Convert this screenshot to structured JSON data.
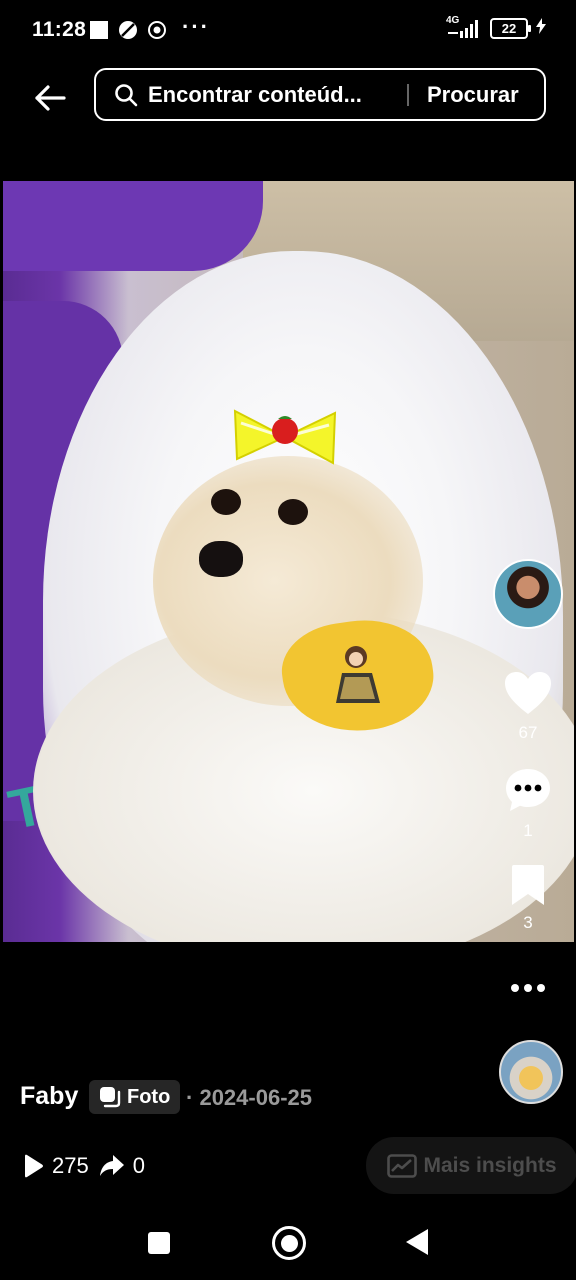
{
  "status_bar": {
    "time": "11:28",
    "ellipsis": "···",
    "network": "4G",
    "battery": "22"
  },
  "search": {
    "query": "Encontrar conteúd...",
    "button_label": "Procurar"
  },
  "post": {
    "likes": "67",
    "comments": "1",
    "saves": "3",
    "author": "Faby",
    "type_label": "Foto",
    "date_separator": "·",
    "date": "2024-06-25",
    "views": "275",
    "shares": "0",
    "insights_label": "Mais insights"
  },
  "colors": {
    "background": "#000000",
    "insights_text": "#4d4d4d",
    "date_text": "#9a9a9a"
  }
}
